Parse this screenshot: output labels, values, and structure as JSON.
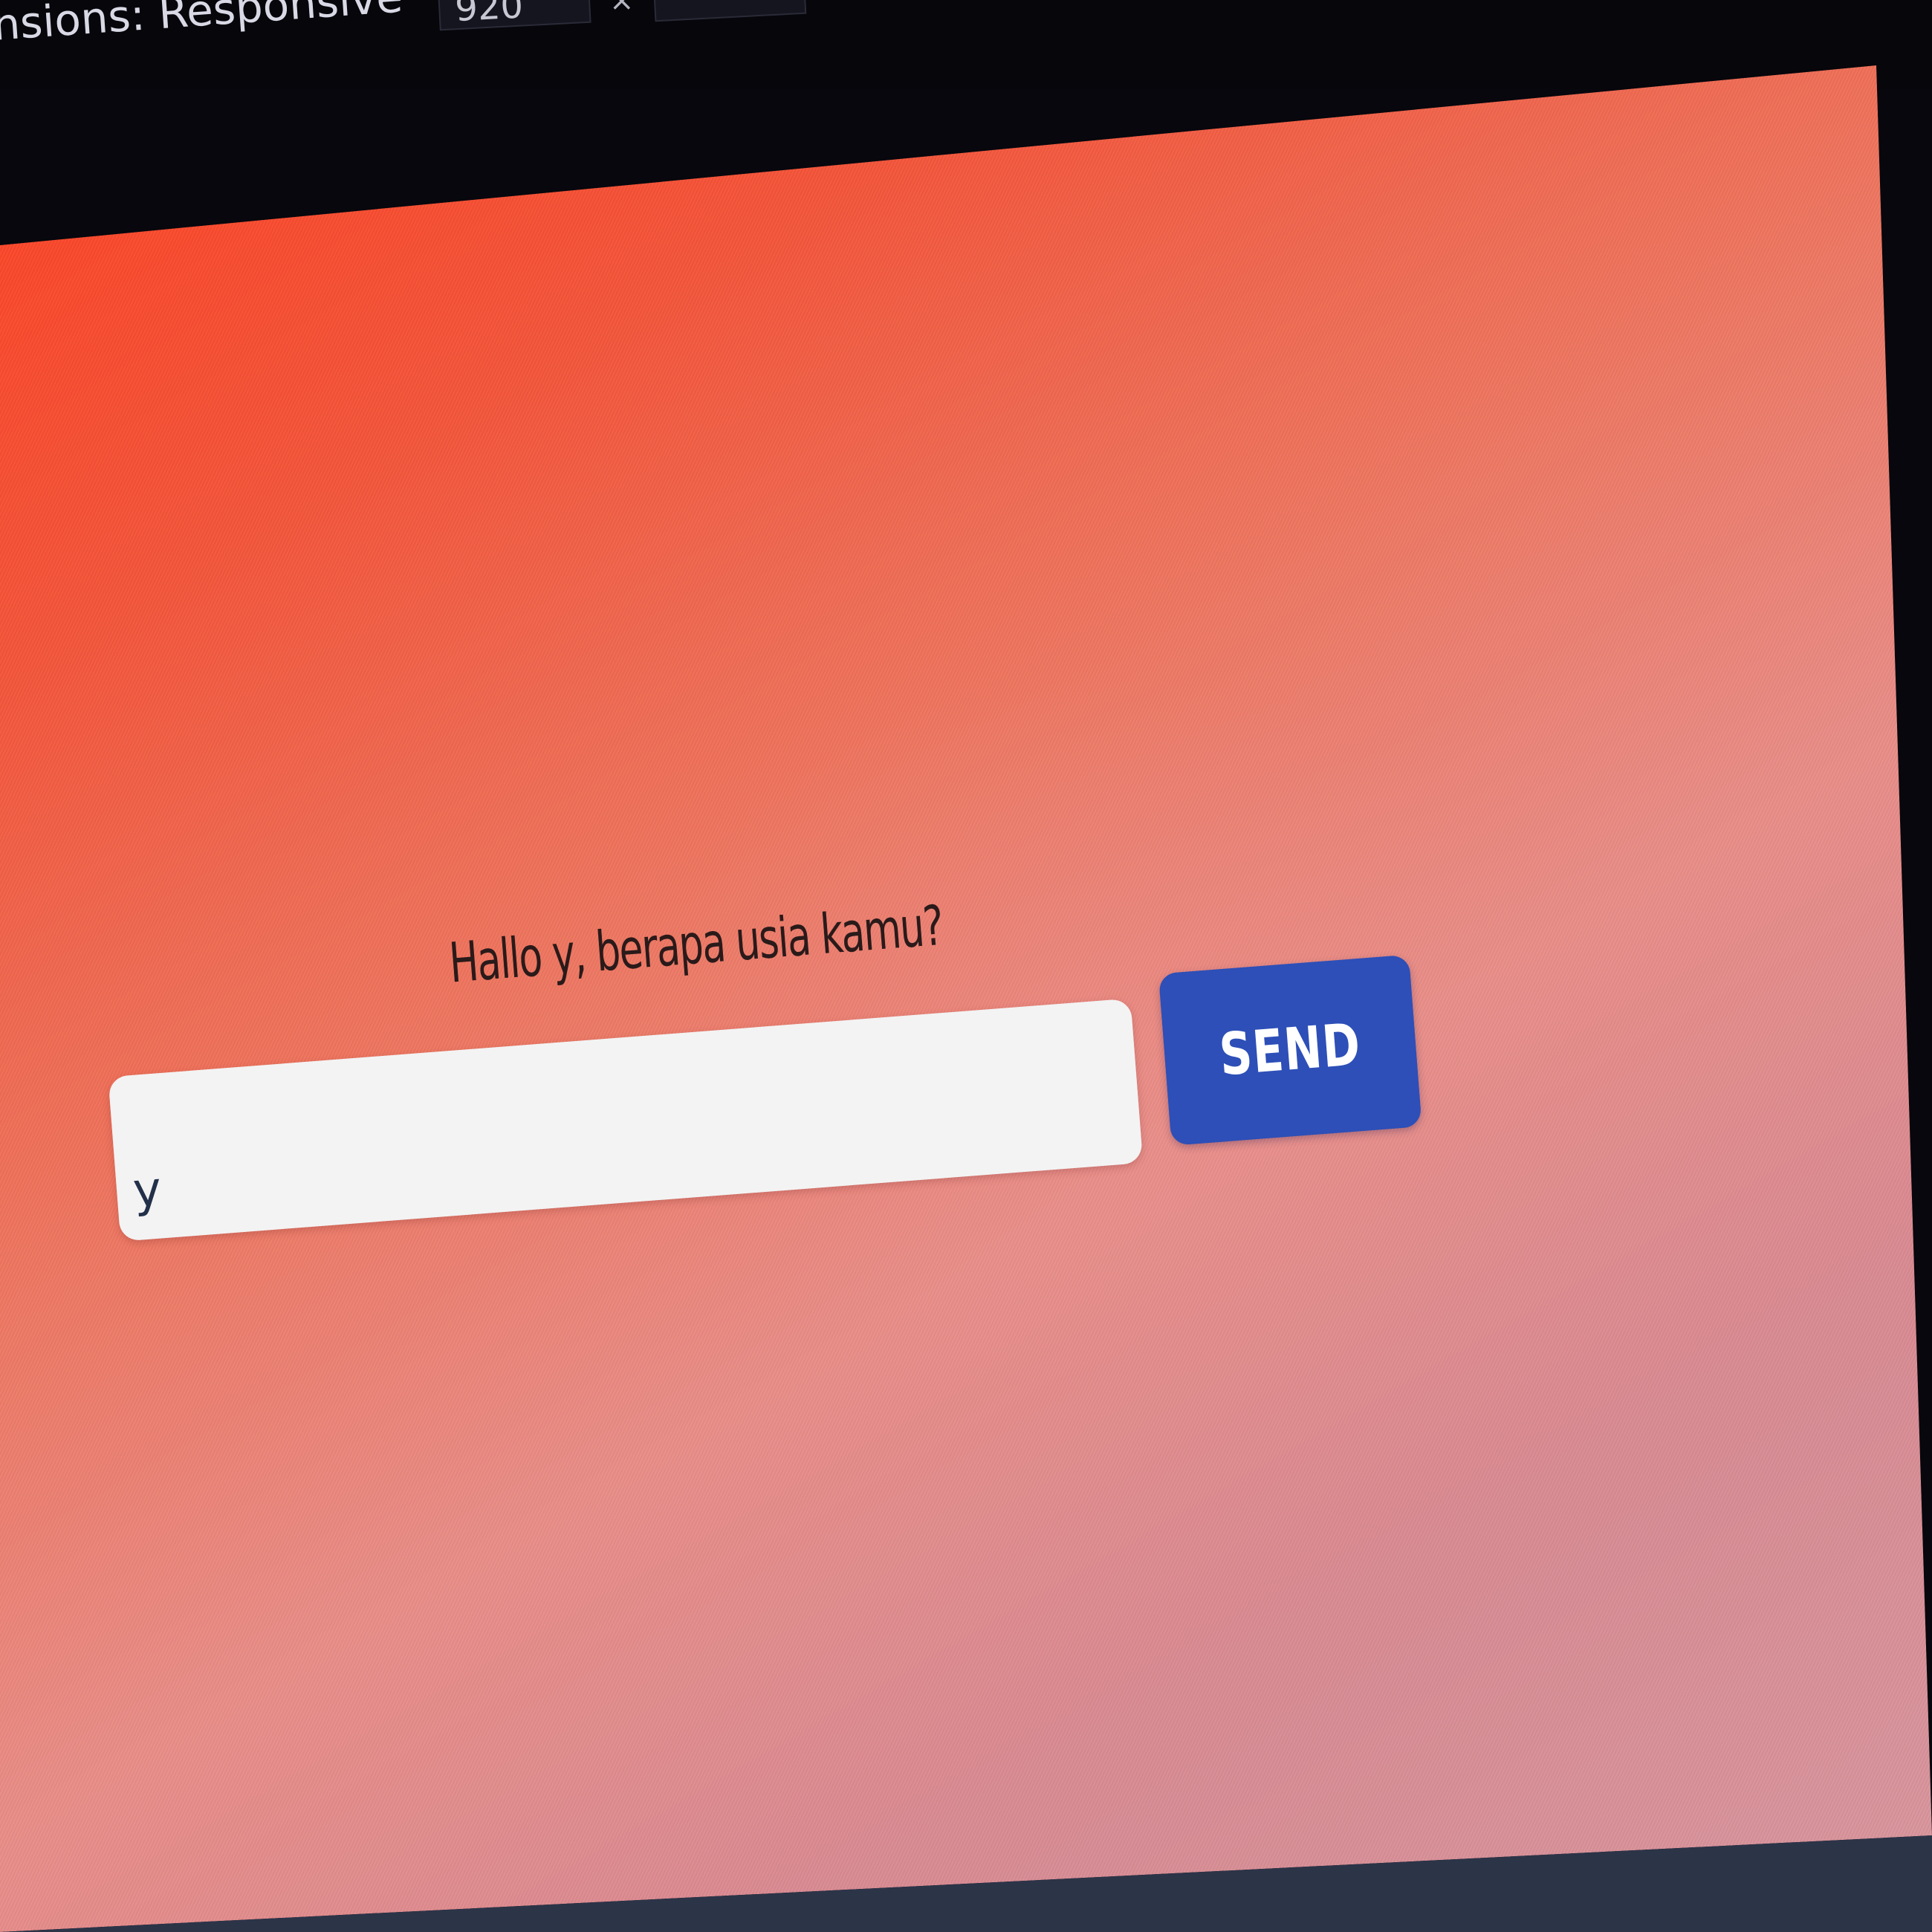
{
  "devtools": {
    "dimensions_label": "nsions:",
    "dimensions_mode": "Responsive",
    "width_value": "920",
    "times_symbol": "×"
  },
  "form": {
    "question": "Hallo y, berapa usia kamu?",
    "input_value": "y",
    "send_label": "SEND"
  },
  "colors": {
    "background_top": "#ff3f20",
    "background_bottom": "#d9969e",
    "send_button": "#2d4fb7",
    "input_background": "#f3f3f3"
  }
}
